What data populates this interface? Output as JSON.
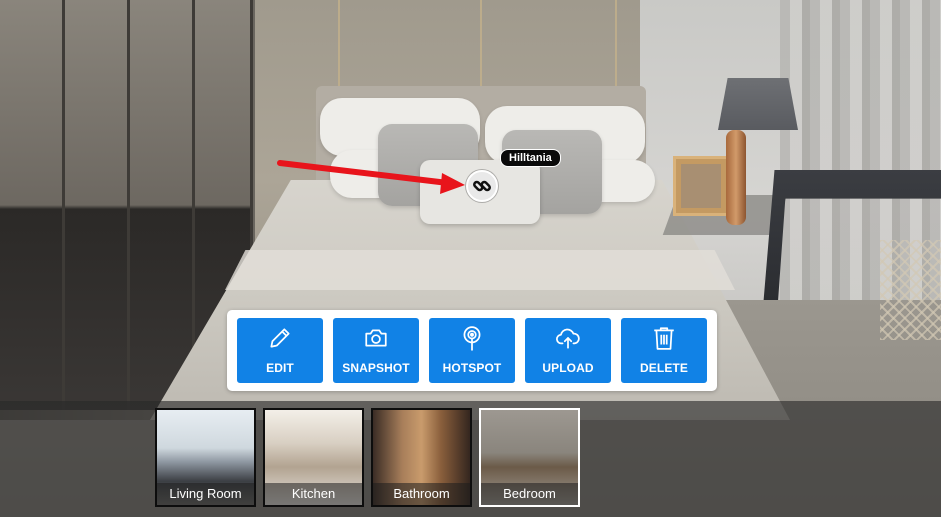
{
  "hotspot": {
    "tooltip": "Hilltania",
    "icon": "link-icon"
  },
  "toolbar": {
    "accent_color": "#1182e6",
    "buttons": [
      {
        "label": "EDIT",
        "icon": "pencil-icon"
      },
      {
        "label": "SNAPSHOT",
        "icon": "camera-icon"
      },
      {
        "label": "HOTSPOT",
        "icon": "hotspot-icon"
      },
      {
        "label": "UPLOAD",
        "icon": "cloud-upload-icon"
      },
      {
        "label": "DELETE",
        "icon": "trash-icon"
      }
    ]
  },
  "scenes": [
    {
      "label": "Living Room",
      "active": false
    },
    {
      "label": "Kitchen",
      "active": false
    },
    {
      "label": "Bathroom",
      "active": false
    },
    {
      "label": "Bedroom",
      "active": true
    }
  ],
  "annotation_arrow_color": "#e8141b"
}
